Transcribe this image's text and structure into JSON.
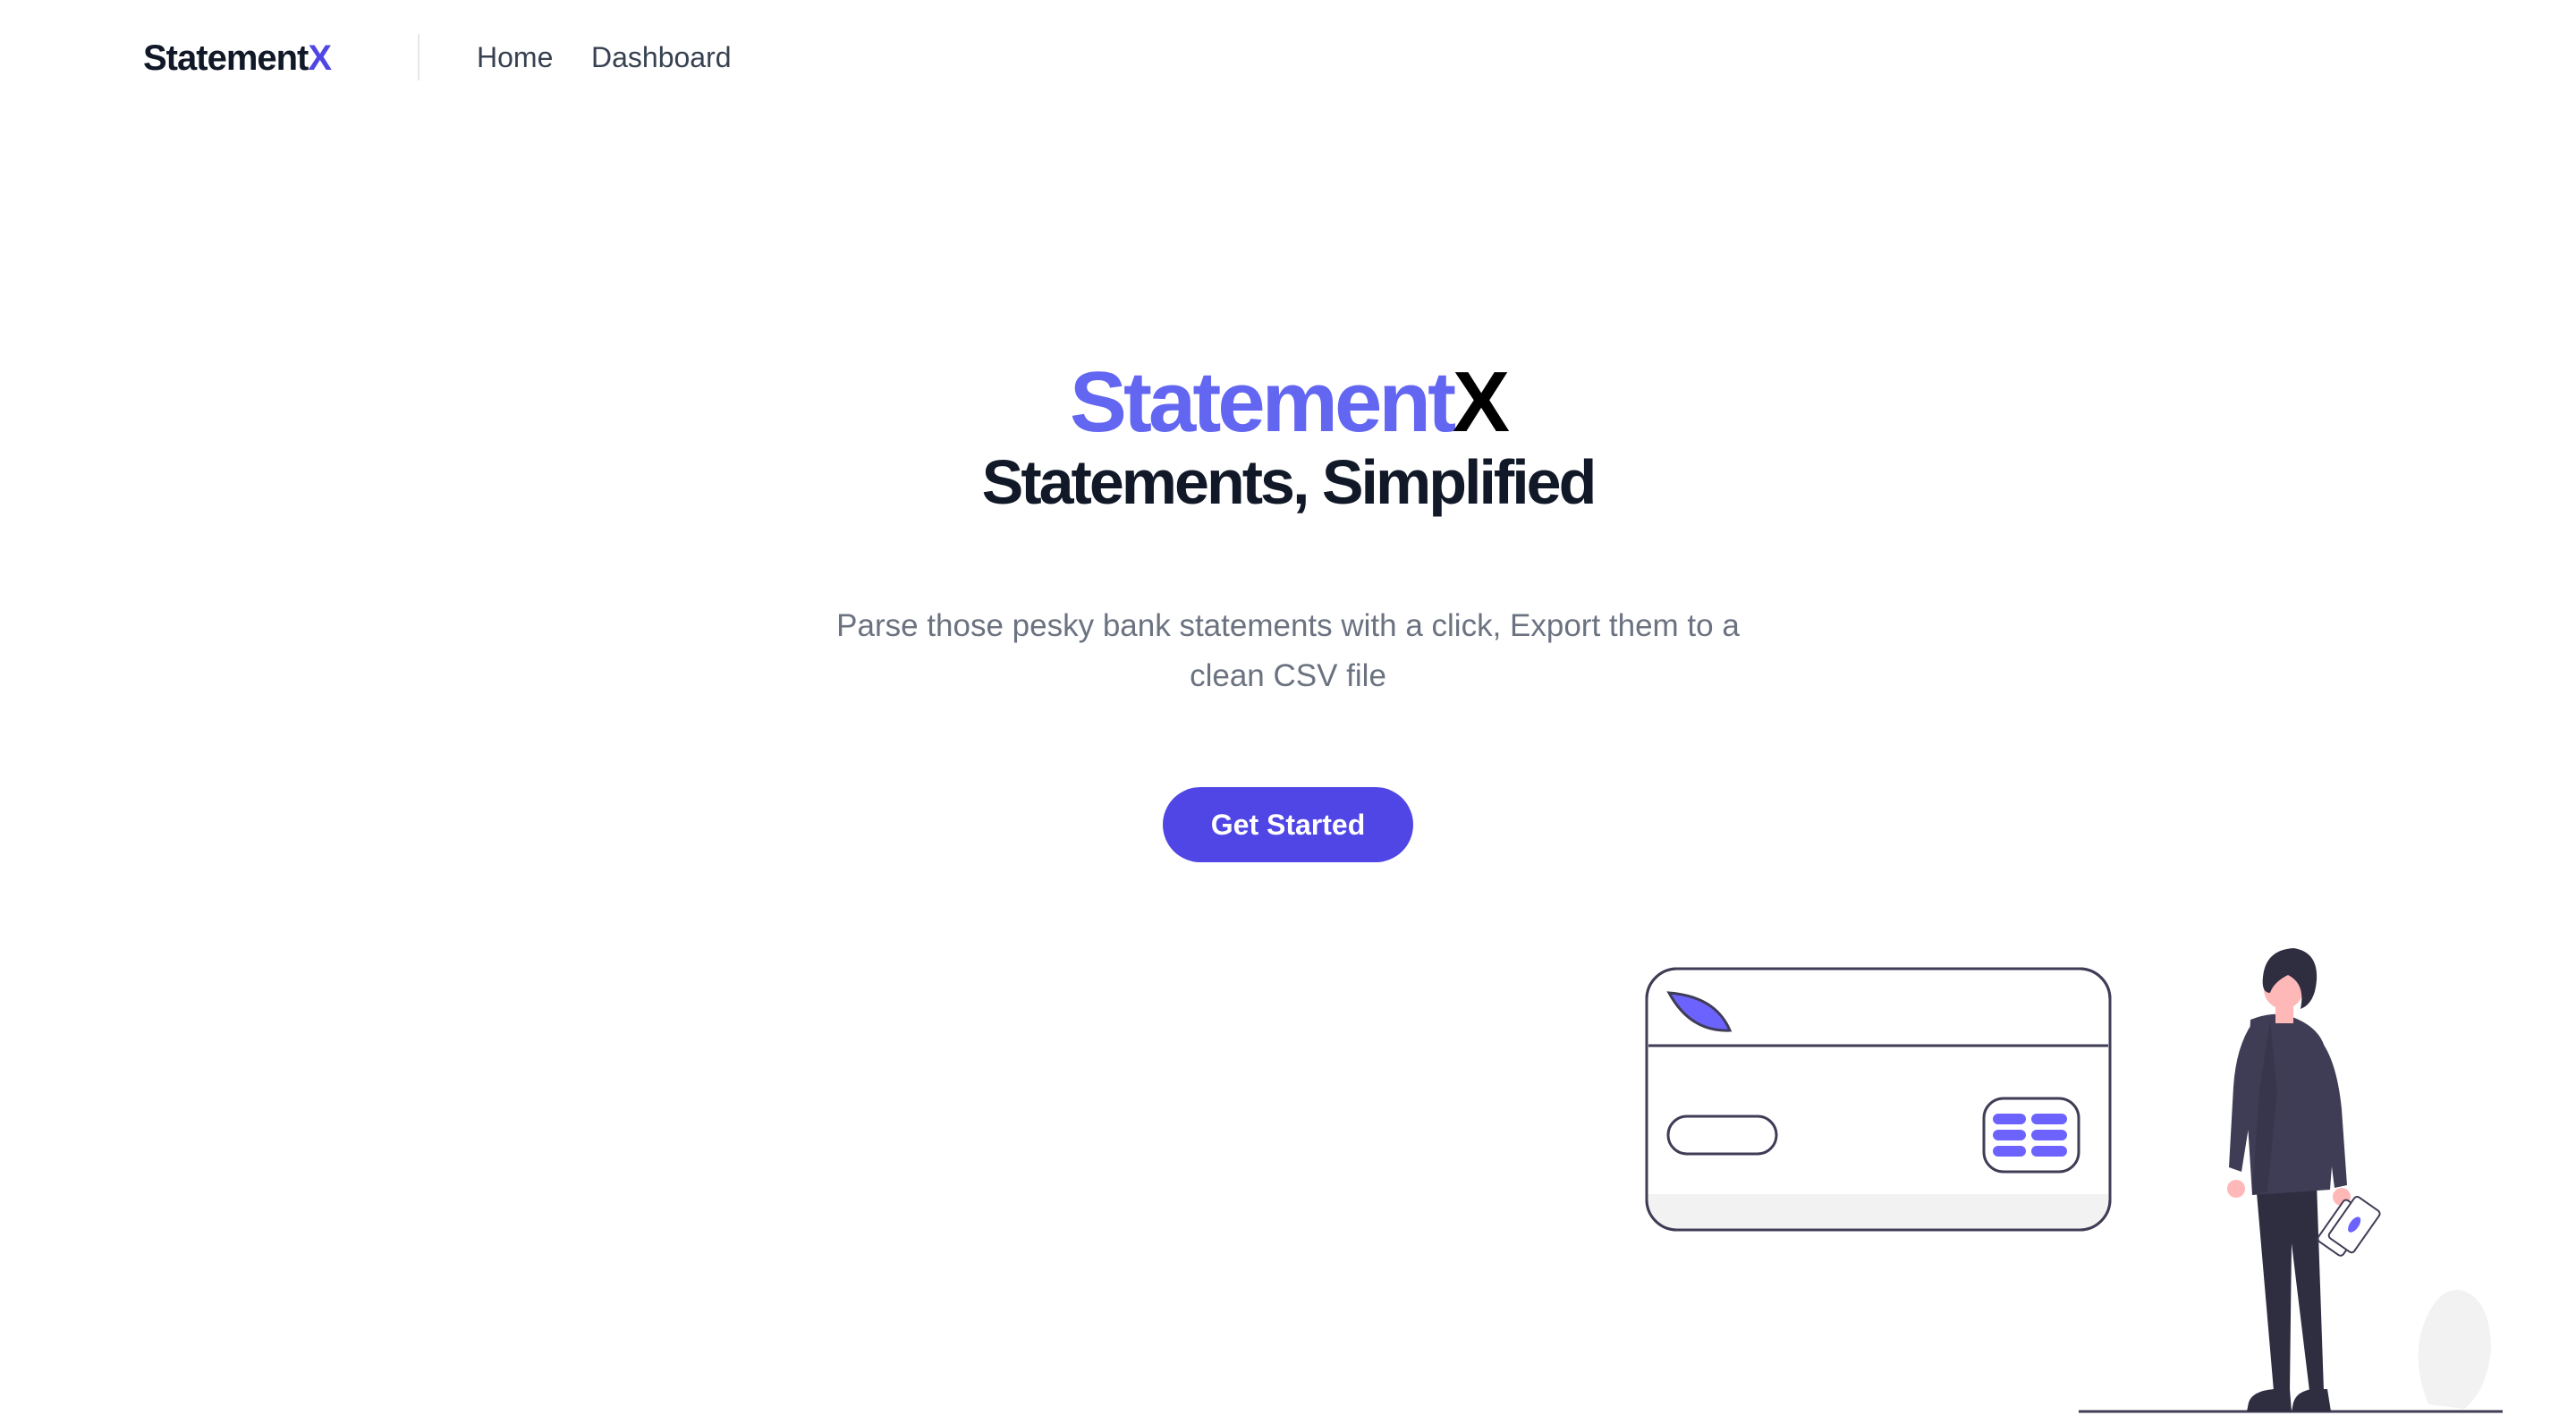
{
  "nav": {
    "brand_main": "Statement",
    "brand_x": "X",
    "links": [
      {
        "label": "Home"
      },
      {
        "label": "Dashboard"
      }
    ]
  },
  "hero": {
    "title_main": "Statement",
    "title_x": "X",
    "subtitle": "Statements, Simplified",
    "description": "Parse those pesky bank statements with a click, Export them to a clean CSV file",
    "cta_label": "Get Started"
  },
  "colors": {
    "brand_accent": "#4f46e5",
    "title_accent": "#6366f1",
    "text_dark": "#111827",
    "text_muted": "#6b7280"
  },
  "illustration": {
    "icon": "person-with-credit-card-illustration"
  }
}
